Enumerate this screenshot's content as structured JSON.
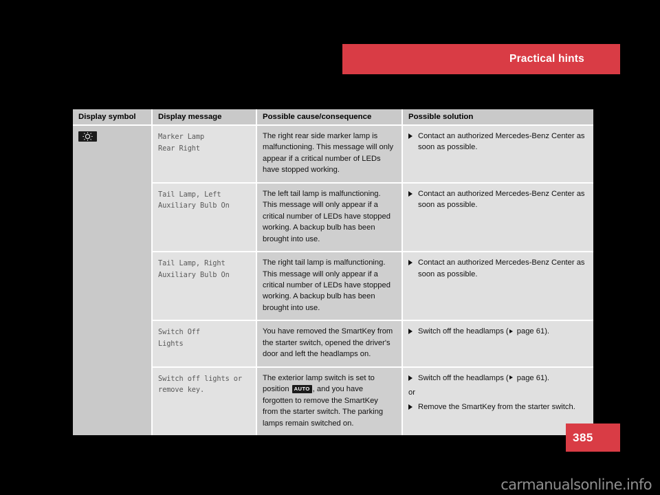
{
  "header": {
    "title": "Practical hints",
    "banner_color": "#d93c45"
  },
  "page": {
    "number": "385",
    "number_box_color": "#d93c45",
    "watermark": "carmanualsonline.info",
    "background_color": "#000000"
  },
  "table": {
    "columns": [
      {
        "key": "symbol",
        "label": "Display symbol"
      },
      {
        "key": "message",
        "label": "Display message"
      },
      {
        "key": "cause",
        "label": "Possible cause/consequence"
      },
      {
        "key": "solution",
        "label": "Possible solution"
      }
    ],
    "header_bg": "#c9c9c9",
    "rows": [
      {
        "symbol_icon": "lamp-indicator-icon",
        "message": "Marker Lamp\nRear Right",
        "cause": "The right rear side marker lamp is malfunctioning. This message will only appear if a critical number of LEDs have stopped working.",
        "solutions": [
          {
            "type": "bullet",
            "text": "Contact an authorized Mercedes-Benz Center as soon as possible."
          }
        ]
      },
      {
        "symbol_icon": "",
        "message": "Tail Lamp, Left\nAuxiliary Bulb On",
        "cause": "The left tail lamp is malfunctioning. This message will only appear if a critical number of LEDs have stopped working. A backup bulb has been brought into use.",
        "solutions": [
          {
            "type": "bullet",
            "text": "Contact an authorized Mercedes-Benz Center as soon as possible."
          }
        ]
      },
      {
        "symbol_icon": "",
        "message": "Tail Lamp, Right\nAuxiliary Bulb On",
        "cause": "The right tail lamp is malfunctioning. This message will only appear if a critical number of LEDs have stopped working. A backup bulb has been brought into use.",
        "solutions": [
          {
            "type": "bullet",
            "text": "Contact an authorized Mercedes-Benz Center as soon as possible."
          }
        ]
      },
      {
        "symbol_icon": "",
        "message": "Switch Off\nLights",
        "cause": "You have removed the SmartKey from the starter switch, opened the driver's door and left the headlamps on.",
        "solutions": [
          {
            "type": "bullet",
            "text_before_ref": "Switch off the headlamps (",
            "page_ref": " page 61).",
            "has_page_ref": true
          }
        ]
      },
      {
        "symbol_icon": "",
        "message": "Switch off lights or\nremove key.",
        "cause_part1": "The exterior lamp switch is set to position ",
        "cause_badge": "AUTO",
        "cause_part2": ", and you have forgotten to remove the SmartKey from the starter switch. The parking lamps remain switched on.",
        "solutions": [
          {
            "type": "bullet",
            "text_before_ref": "Switch off the headlamps (",
            "page_ref": " page 61).",
            "has_page_ref": true
          },
          {
            "type": "or",
            "text": "or"
          },
          {
            "type": "bullet",
            "text": "Remove the SmartKey from the starter switch."
          }
        ]
      }
    ]
  }
}
